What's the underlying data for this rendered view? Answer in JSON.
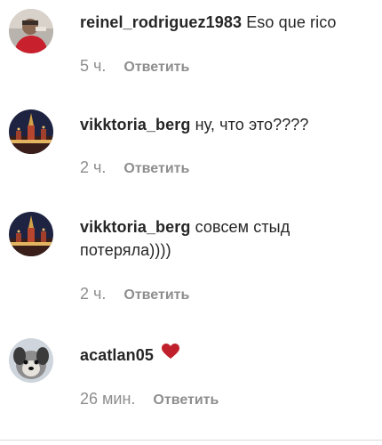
{
  "comments": [
    {
      "username": "reinel_rodriguez1983",
      "text": " Eso que rico",
      "time": "5 ч.",
      "reply": "Ответить",
      "avatar_icon": "person-avatar"
    },
    {
      "username": "vikktoria_berg",
      "text": " ну, что это????",
      "time": "2 ч.",
      "reply": "Ответить",
      "avatar_icon": "kremlin-night-avatar"
    },
    {
      "username": "vikktoria_berg",
      "text": " совсем стыд потеряла))))",
      "time": "2 ч.",
      "reply": "Ответить",
      "avatar_icon": "kremlin-night-avatar"
    },
    {
      "username": "acatlan05",
      "text": "",
      "time": "26 мин.",
      "reply": "Ответить",
      "avatar_icon": "dog-avatar",
      "emoji": "red-heart-icon"
    }
  ],
  "colors": {
    "text": "#262626",
    "secondary": "#8e8e8e",
    "heart": "#c0202b"
  }
}
